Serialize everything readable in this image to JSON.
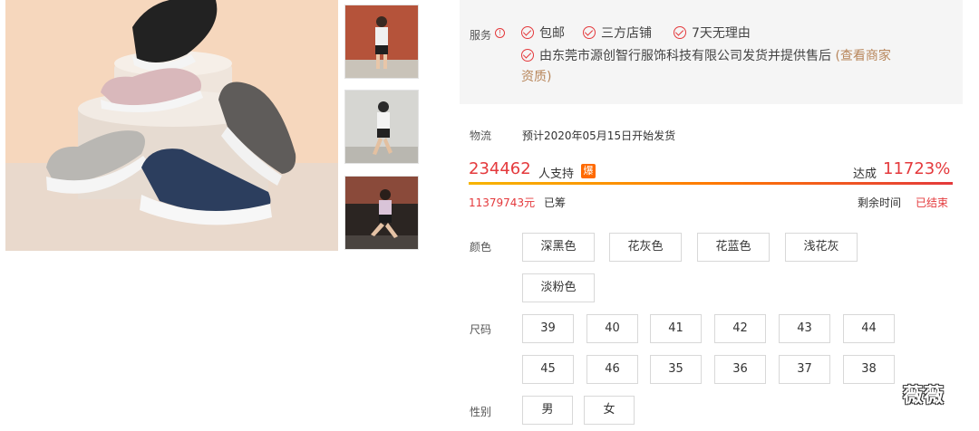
{
  "service": {
    "label": "服务",
    "info_icon": "!",
    "items": [
      "包邮",
      "三方店铺",
      "7天无理由"
    ],
    "seller_line1": "由东莞市源创智行服饰科技有限公司发货并提供售后",
    "seller_link_part1": "(查看商家",
    "seller_link_part2": "资质)"
  },
  "logistics": {
    "label": "物流",
    "value": "预计2020年05月15日开始发货"
  },
  "funding": {
    "supporters": "234462",
    "supporters_text": "人支持",
    "hot_badge": "爆",
    "reach_label": "达成",
    "reach_percent": "11723%",
    "progress": 1.0,
    "raised_amount": "11379743元",
    "raised_text": "已筹",
    "remaining_label": "剩余时间",
    "remaining_value": "已结束"
  },
  "options": {
    "color_label": "颜色",
    "colors": [
      "深黑色",
      "花灰色",
      "花蓝色",
      "浅花灰",
      "淡粉色"
    ],
    "size_label": "尺码",
    "sizes": [
      "39",
      "40",
      "41",
      "42",
      "43",
      "44",
      "45",
      "46",
      "35",
      "36",
      "37",
      "38"
    ],
    "gender_label": "性别",
    "genders": [
      "男",
      "女"
    ]
  },
  "watermark": "薇薇",
  "colors": {
    "accent_red": "#e4393c",
    "link_brown": "#b8865b",
    "hot_orange": "#ff6a00"
  }
}
